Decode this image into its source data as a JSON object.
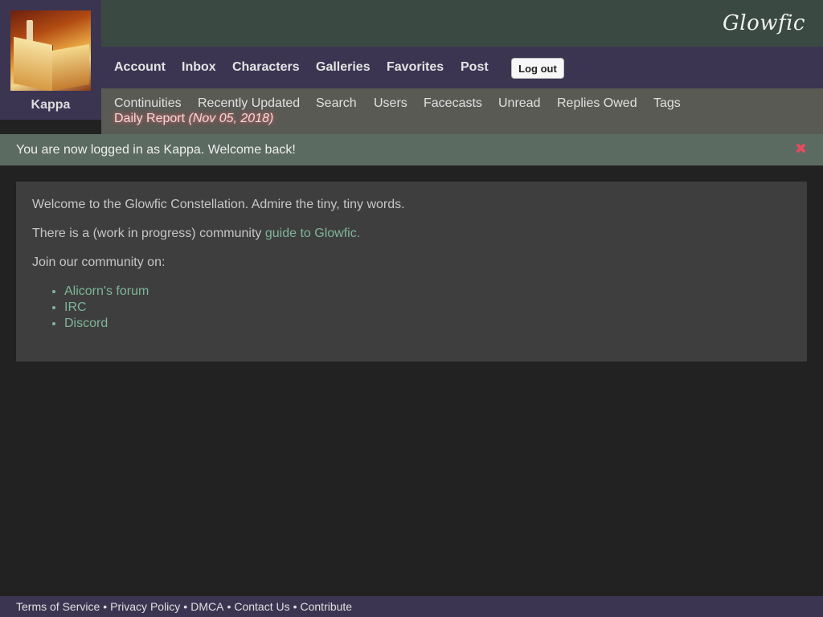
{
  "site": {
    "logo": "Glowfic"
  },
  "user": {
    "name": "Kappa"
  },
  "main_nav": {
    "items": [
      "Account",
      "Inbox",
      "Characters",
      "Galleries",
      "Favorites",
      "Post"
    ],
    "logout_label": "Log out"
  },
  "sub_nav": {
    "items": [
      "Continuities",
      "Recently Updated",
      "Search",
      "Users",
      "Facecasts",
      "Unread",
      "Replies Owed",
      "Tags"
    ],
    "daily_report_label": "Daily Report",
    "daily_report_date": "(Nov 05, 2018)"
  },
  "flash": {
    "message": "You are now logged in as Kappa. Welcome back!",
    "close_icon": "✖"
  },
  "content": {
    "welcome": "Welcome to the Glowfic Constellation. Admire the tiny, tiny words.",
    "guide_prefix": "There is a (work in progress) community ",
    "guide_link": "guide to Glowfic.",
    "join_text": "Join our community on:",
    "community_links": [
      "Alicorn's forum",
      "IRC",
      "Discord"
    ]
  },
  "footer": {
    "links": [
      "Terms of Service",
      "Privacy Policy",
      "DMCA",
      "Contact Us",
      "Contribute"
    ],
    "separator": "•"
  },
  "colors": {
    "header_bg": "#3a4a43",
    "nav_bg": "#3b3552",
    "subnav_bg": "#5a5a55",
    "flash_bg": "#5c6b62",
    "page_bg": "#222222",
    "content_bg": "#3e3e3e",
    "link": "#7fb59a",
    "close_icon": "#e84a5f"
  }
}
